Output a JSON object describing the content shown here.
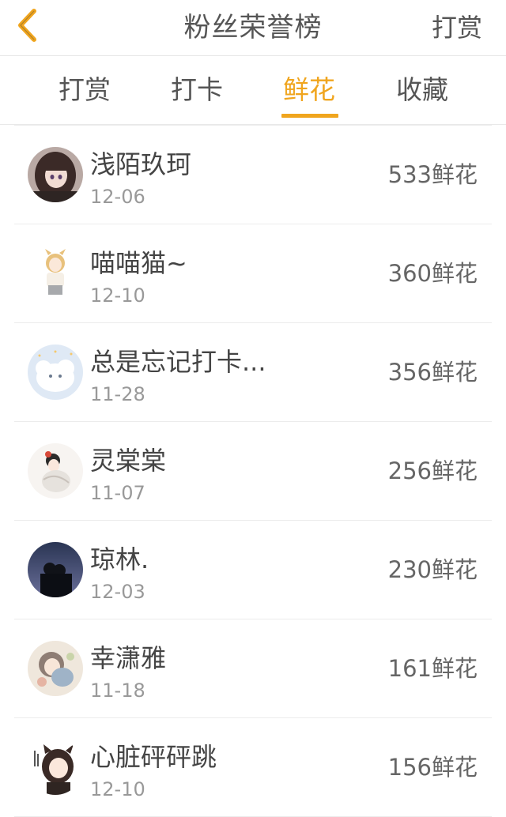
{
  "header": {
    "title": "粉丝荣誉榜",
    "right_action": "打赏",
    "back_icon": "chevron-left-icon",
    "accent_color": "#f0a51e"
  },
  "tabs": [
    {
      "label": "打赏",
      "active": false
    },
    {
      "label": "打卡",
      "active": false
    },
    {
      "label": "鲜花",
      "active": true
    },
    {
      "label": "收藏",
      "active": false
    }
  ],
  "list": {
    "unit": "鲜花",
    "rows": [
      {
        "name": "浅陌玖珂",
        "date": "12-06",
        "count": "533"
      },
      {
        "name": "喵喵猫~",
        "date": "12-10",
        "count": "360"
      },
      {
        "name": "总是忘记打卡...",
        "date": "11-28",
        "count": "356"
      },
      {
        "name": "灵棠棠",
        "date": "11-07",
        "count": "256"
      },
      {
        "name": "琼林.",
        "date": "12-03",
        "count": "230"
      },
      {
        "name": "幸潇雅",
        "date": "11-18",
        "count": "161"
      },
      {
        "name": "心脏砰砰跳",
        "date": "12-10",
        "count": "156"
      }
    ]
  }
}
